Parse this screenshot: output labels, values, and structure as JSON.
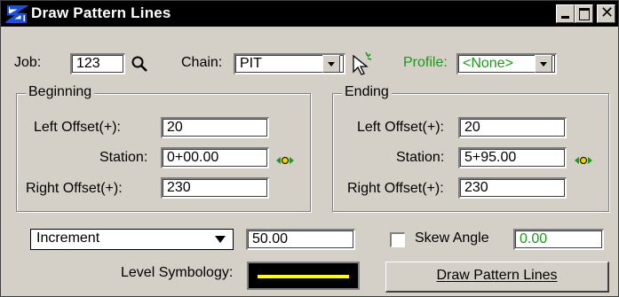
{
  "window": {
    "title": "Draw Pattern Lines"
  },
  "job": {
    "label": "Job:",
    "value": "123"
  },
  "chain": {
    "label": "Chain:",
    "value": "PIT"
  },
  "profile": {
    "label": "Profile:",
    "value": "<None>"
  },
  "beginning": {
    "legend": "Beginning",
    "left_offset_label": "Left Offset(+):",
    "left_offset_value": "20",
    "station_label": "Station:",
    "station_value": "0+00.00",
    "right_offset_label": "Right Offset(+):",
    "right_offset_value": "230"
  },
  "ending": {
    "legend": "Ending",
    "left_offset_label": "Left Offset(+):",
    "left_offset_value": "20",
    "station_label": "Station:",
    "station_value": "5+95.00",
    "right_offset_label": "Right Offset(+):",
    "right_offset_value": "230"
  },
  "mode": {
    "value": "Increment",
    "amount": "50.00"
  },
  "skew": {
    "label": "Skew Angle",
    "checked": false,
    "value": "0.00"
  },
  "symbology": {
    "label": "Level Symbology:",
    "line_color": "#ffff00"
  },
  "draw_button": {
    "label": "Draw Pattern Lines"
  },
  "colors": {
    "profile_green": "#1a9a1a",
    "title_bg": "#000000",
    "dialog_bg": "#d4d0c8"
  }
}
